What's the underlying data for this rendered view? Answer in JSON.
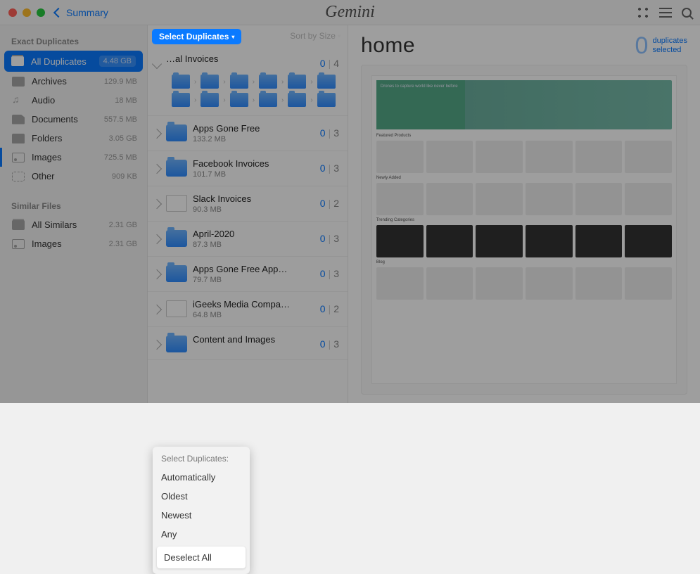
{
  "titlebar": {
    "back_label": "Summary",
    "app_name": "Gemini"
  },
  "sidebar": {
    "sections": [
      {
        "header": "Exact Duplicates",
        "items": [
          {
            "label": "All Duplicates",
            "size": "4.48 GB",
            "icon": "stack",
            "selected": true
          },
          {
            "label": "Archives",
            "size": "129.9 MB",
            "icon": "archive"
          },
          {
            "label": "Audio",
            "size": "18 MB",
            "icon": "audio"
          },
          {
            "label": "Documents",
            "size": "557.5 MB",
            "icon": "doc"
          },
          {
            "label": "Folders",
            "size": "3.05 GB",
            "icon": "folder"
          },
          {
            "label": "Images",
            "size": "725.5 MB",
            "icon": "image",
            "bar": true
          },
          {
            "label": "Other",
            "size": "909 KB",
            "icon": "other"
          }
        ]
      },
      {
        "header": "Similar Files",
        "items": [
          {
            "label": "All Similars",
            "size": "2.31 GB",
            "icon": "stack"
          },
          {
            "label": "Images",
            "size": "2.31 GB",
            "icon": "image"
          }
        ]
      }
    ]
  },
  "middle": {
    "select_label": "Select Duplicates",
    "sort_label": "Sort by Size",
    "groups": [
      {
        "title": "…al Invoices",
        "size": "",
        "selected": 0,
        "total": 4,
        "icon": "none",
        "open": true,
        "thumbs": 12
      },
      {
        "title": "Apps Gone Free",
        "size": "133.2 MB",
        "selected": 0,
        "total": 3,
        "icon": "folder"
      },
      {
        "title": "Facebook Invoices",
        "size": "101.7 MB",
        "selected": 0,
        "total": 3,
        "icon": "folder"
      },
      {
        "title": "Slack Invoices",
        "size": "90.3 MB",
        "selected": 0,
        "total": 2,
        "icon": "file"
      },
      {
        "title": "April-2020",
        "size": "87.3 MB",
        "selected": 0,
        "total": 3,
        "icon": "folder"
      },
      {
        "title": "Apps Gone Free App…",
        "size": "79.7 MB",
        "selected": 0,
        "total": 3,
        "icon": "folder"
      },
      {
        "title": "iGeeks Media Compa…",
        "size": "64.8 MB",
        "selected": 0,
        "total": 2,
        "icon": "file"
      },
      {
        "title": "Content and Images",
        "size": "",
        "selected": 0,
        "total": 3,
        "icon": "folder"
      }
    ]
  },
  "preview": {
    "title": "home",
    "count": "0",
    "count_label_1": "duplicates",
    "count_label_2": "selected"
  },
  "popover": {
    "header": "Select Duplicates:",
    "items": [
      "Automatically",
      "Oldest",
      "Newest",
      "Any",
      "Deselect All"
    ],
    "highlighted": "Deselect All"
  }
}
